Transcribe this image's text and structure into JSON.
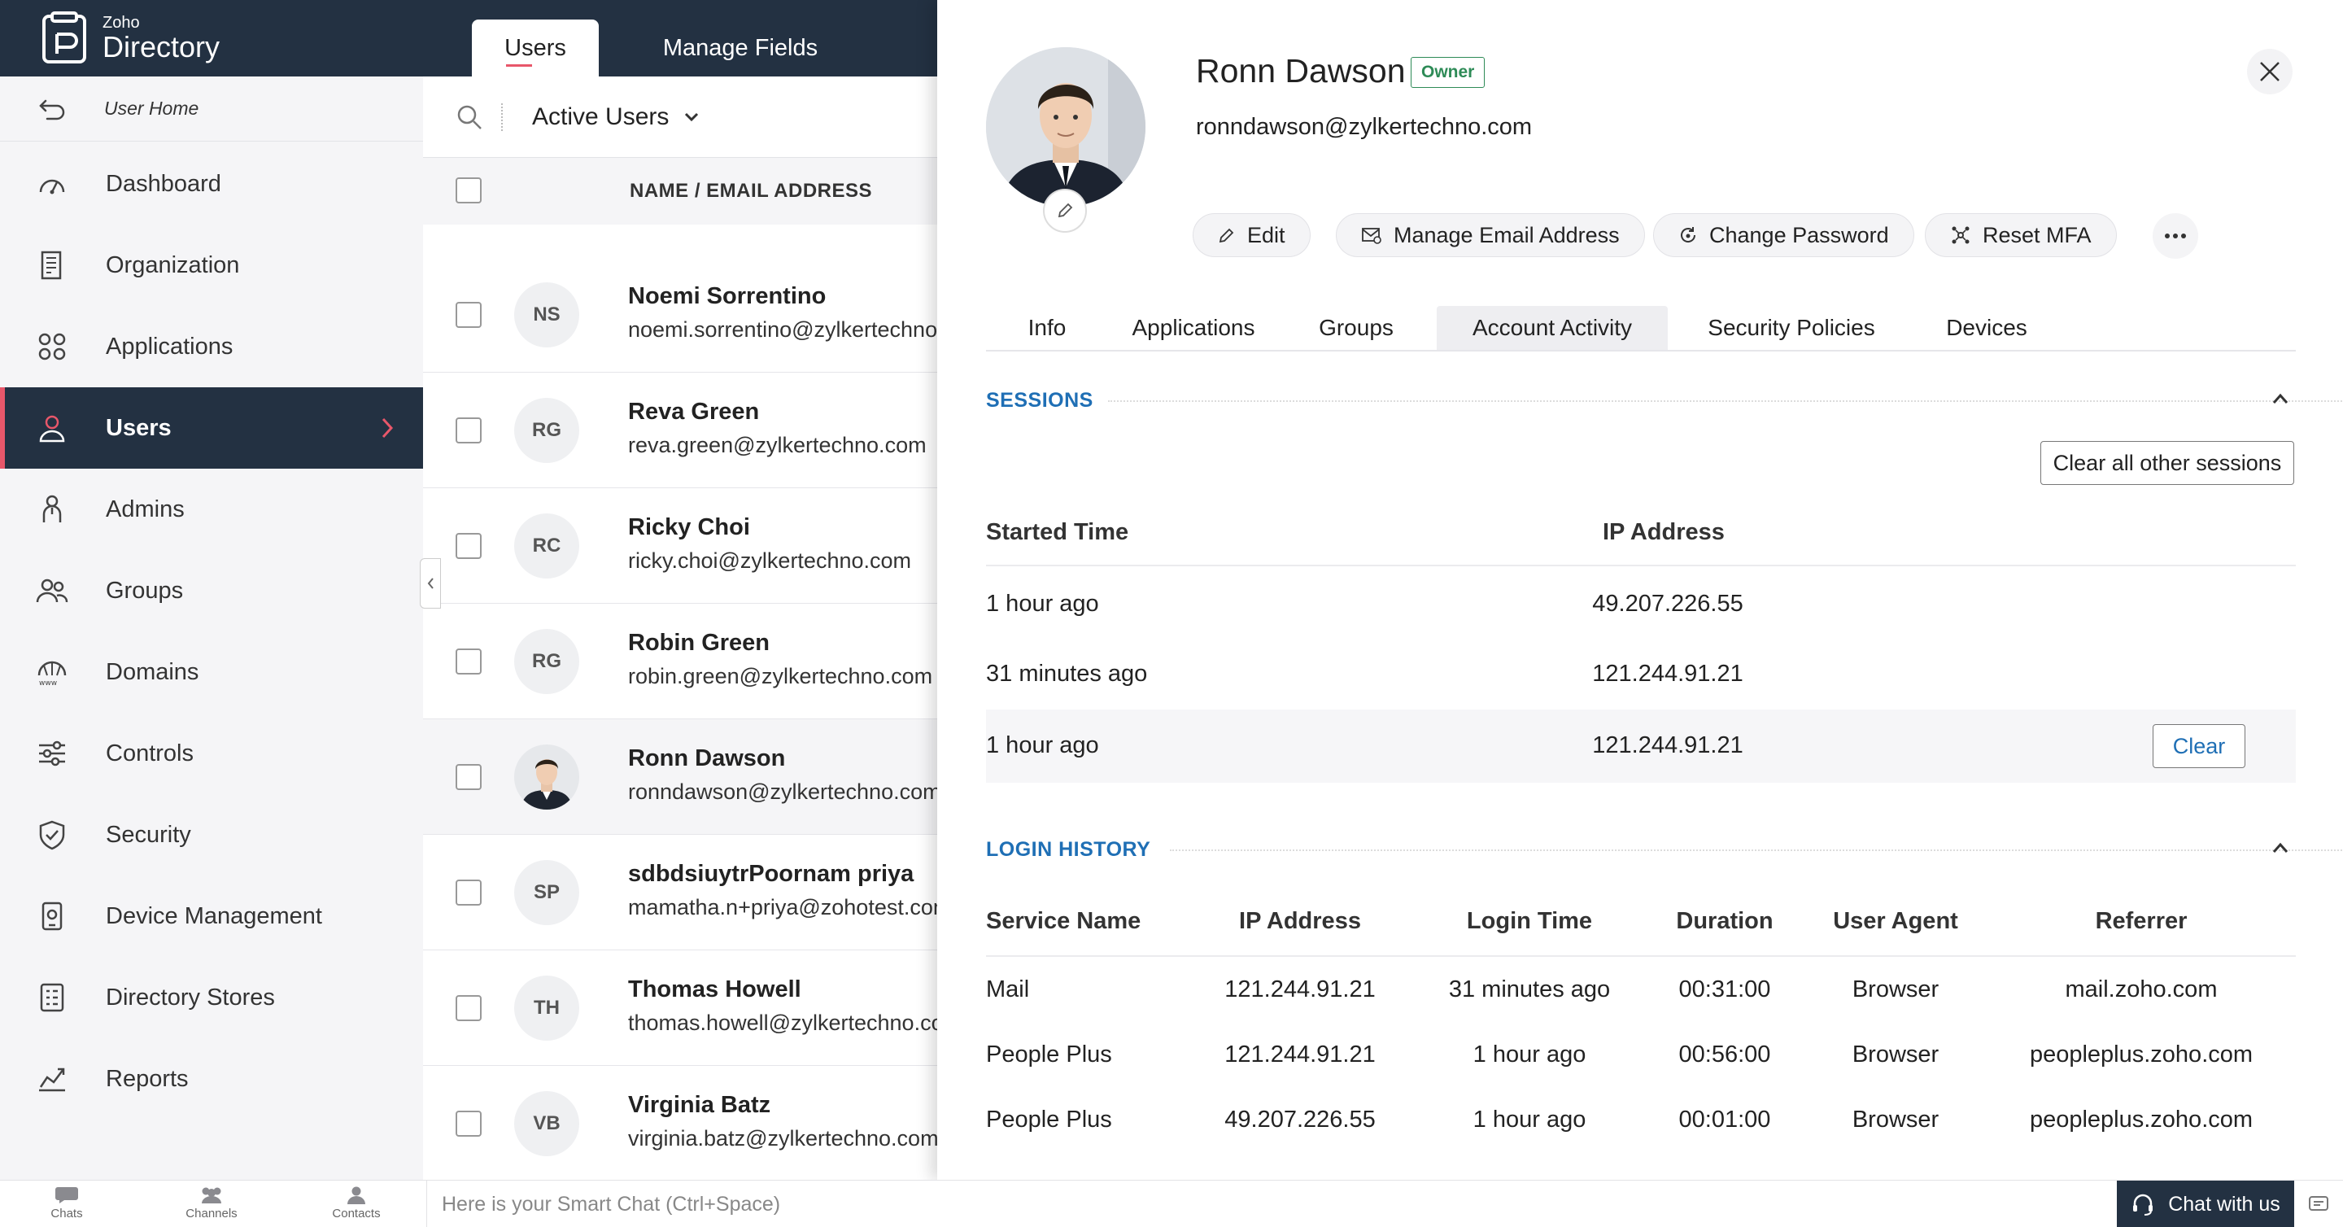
{
  "app": {
    "brand_small": "Zoho",
    "brand_large": "Directory"
  },
  "sidebar": {
    "home_label": "User Home",
    "items": [
      {
        "label": "Dashboard",
        "icon": "dashboard-icon"
      },
      {
        "label": "Organization",
        "icon": "organization-icon"
      },
      {
        "label": "Applications",
        "icon": "applications-icon"
      },
      {
        "label": "Users",
        "icon": "user-icon",
        "active": true
      },
      {
        "label": "Admins",
        "icon": "admin-icon"
      },
      {
        "label": "Groups",
        "icon": "groups-icon"
      },
      {
        "label": "Domains",
        "icon": "domains-icon"
      },
      {
        "label": "Controls",
        "icon": "controls-icon"
      },
      {
        "label": "Security",
        "icon": "security-shield-icon"
      },
      {
        "label": "Device Management",
        "icon": "device-icon"
      },
      {
        "label": "Directory Stores",
        "icon": "store-icon"
      },
      {
        "label": "Reports",
        "icon": "reports-icon"
      }
    ]
  },
  "list": {
    "tabs": [
      {
        "label": "Users",
        "active": true
      },
      {
        "label": "Manage Fields",
        "active": false
      }
    ],
    "filter_label": "Active Users",
    "column_header": "NAME / EMAIL ADDRESS",
    "rows": [
      {
        "initials": "NS",
        "name": "Noemi Sorrentino",
        "email": "noemi.sorrentino@zylkertechno.com"
      },
      {
        "initials": "RG",
        "name": "Reva Green",
        "email": "reva.green@zylkertechno.com"
      },
      {
        "initials": "RC",
        "name": "Ricky Choi",
        "email": "ricky.choi@zylkertechno.com"
      },
      {
        "initials": "RG",
        "name": "Robin Green",
        "email": "robin.green@zylkertechno.com"
      },
      {
        "initials": "",
        "name": "Ronn Dawson",
        "email": "ronndawson@zylkertechno.com",
        "selected": true
      },
      {
        "initials": "SP",
        "name": "sdbdsiuytrPoornam priya",
        "email": "mamatha.n+priya@zohotest.com"
      },
      {
        "initials": "TH",
        "name": "Thomas Howell",
        "email": "thomas.howell@zylkertechno.com"
      },
      {
        "initials": "VB",
        "name": "Virginia Batz",
        "email": "virginia.batz@zylkertechno.com"
      }
    ]
  },
  "profile": {
    "name": "Ronn Dawson",
    "badge": "Owner",
    "email": "ronndawson@zylkertechno.com",
    "actions": {
      "edit": "Edit",
      "manage_email": "Manage Email Address",
      "change_password": "Change Password",
      "reset_mfa": "Reset MFA"
    },
    "tabs": [
      "Info",
      "Applications",
      "Groups",
      "Account Activity",
      "Security Policies",
      "Devices"
    ],
    "active_tab": "Account Activity"
  },
  "sessions": {
    "title": "SESSIONS",
    "clear_all_label": "Clear all other sessions",
    "columns": {
      "started": "Started Time",
      "ip": "IP Address"
    },
    "rows": [
      {
        "started": "1 hour ago",
        "ip": "49.207.226.55"
      },
      {
        "started": "31 minutes ago",
        "ip": "121.244.91.21"
      },
      {
        "started": "1 hour ago",
        "ip": "121.244.91.21",
        "action": "Clear"
      }
    ]
  },
  "login_history": {
    "title": "LOGIN HISTORY",
    "columns": {
      "service": "Service Name",
      "ip": "IP Address",
      "time": "Login Time",
      "duration": "Duration",
      "agent": "User Agent",
      "referrer": "Referrer"
    },
    "rows": [
      {
        "service": "Mail",
        "ip": "121.244.91.21",
        "time": "31 minutes ago",
        "duration": "00:31:00",
        "agent": "Browser",
        "referrer": "mail.zoho.com"
      },
      {
        "service": "People Plus",
        "ip": "121.244.91.21",
        "time": "1 hour ago",
        "duration": "00:56:00",
        "agent": "Browser",
        "referrer": "peopleplus.zoho.com"
      },
      {
        "service": "People Plus",
        "ip": "49.207.226.55",
        "time": "1 hour ago",
        "duration": "00:01:00",
        "agent": "Browser",
        "referrer": "peopleplus.zoho.com"
      }
    ]
  },
  "bottombar": {
    "chats": "Chats",
    "channels": "Channels",
    "contacts": "Contacts",
    "smart_chat_placeholder": "Here is your Smart Chat (Ctrl+Space)",
    "chat_with_us": "Chat with us"
  },
  "colors": {
    "navy": "#233142",
    "accent_red": "#e8576a",
    "link_blue": "#1f6fb5",
    "owner_green": "#2e8b57"
  }
}
